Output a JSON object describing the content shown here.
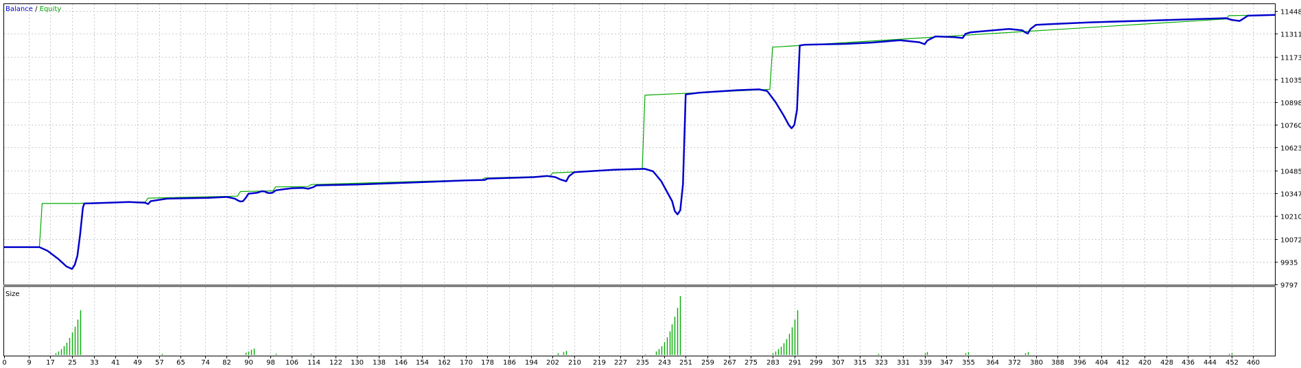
{
  "chart_data": {
    "type": "line",
    "legend": {
      "placement": "top-left",
      "separator": " / ",
      "series": [
        {
          "name": "Balance",
          "color": "#0000cc"
        },
        {
          "name": "Equity",
          "color": "#00aa00"
        }
      ]
    },
    "y_axis": {
      "ticks": [
        "11448",
        "11311",
        "11173",
        "11035",
        "10898",
        "10760",
        "10623",
        "10485",
        "10347",
        "10210",
        "10072",
        "9935",
        "9797"
      ],
      "range": [
        9797,
        11490
      ]
    },
    "x_axis": {
      "ticks": [
        "0",
        "9",
        "17",
        "25",
        "33",
        "41",
        "49",
        "57",
        "65",
        "74",
        "82",
        "90",
        "98",
        "106",
        "114",
        "122",
        "130",
        "138",
        "146",
        "154",
        "162",
        "170",
        "178",
        "186",
        "194",
        "202",
        "210",
        "219",
        "227",
        "235",
        "243",
        "251",
        "259",
        "267",
        "275",
        "283",
        "291",
        "299",
        "307",
        "315",
        "323",
        "331",
        "339",
        "347",
        "355",
        "364",
        "372",
        "380",
        "388",
        "396",
        "404",
        "412",
        "420",
        "428",
        "436",
        "444",
        "452",
        "460"
      ],
      "range": [
        0,
        468
      ]
    },
    "grid": true,
    "series": [
      {
        "name": "Balance",
        "color": "#0000cc",
        "x": [
          0,
          13,
          16,
          20,
          23,
          25,
          26,
          27,
          28,
          29,
          29.5,
          30,
          38,
          46,
          52,
          53,
          54,
          60,
          75,
          82,
          85,
          86,
          87,
          88,
          89,
          90,
          93,
          95,
          96,
          97,
          98,
          99,
          100,
          103,
          106,
          110,
          112,
          114,
          115,
          130,
          150,
          170,
          177,
          178,
          185,
          195,
          200,
          203,
          205,
          207,
          208,
          210,
          225,
          236,
          239,
          242,
          244,
          246,
          247,
          248,
          249,
          250,
          251,
          256,
          270,
          278,
          281,
          284,
          287,
          289,
          290,
          291,
          292,
          293,
          295,
          310,
          320,
          325,
          327,
          330,
          337,
          339,
          340,
          343,
          350,
          353,
          354,
          356,
          370,
          375,
          376,
          377,
          378,
          380,
          400,
          420,
          440,
          450,
          452,
          455,
          456,
          458,
          468
        ],
        "y": [
          10022,
          10022,
          10000,
          9950,
          9905,
          9890,
          9915,
          9970,
          10100,
          10260,
          10284,
          10286,
          10290,
          10295,
          10290,
          10282,
          10300,
          10315,
          10320,
          10325,
          10315,
          10305,
          10298,
          10300,
          10320,
          10345,
          10350,
          10360,
          10358,
          10350,
          10348,
          10352,
          10365,
          10372,
          10378,
          10380,
          10375,
          10385,
          10395,
          10400,
          10412,
          10425,
          10428,
          10436,
          10440,
          10445,
          10452,
          10445,
          10430,
          10420,
          10450,
          10475,
          10490,
          10495,
          10480,
          10420,
          10360,
          10300,
          10240,
          10220,
          10245,
          10400,
          10945,
          10955,
          10970,
          10975,
          10965,
          10900,
          10820,
          10760,
          10740,
          10760,
          10850,
          11240,
          11245,
          11250,
          11258,
          11265,
          11268,
          11272,
          11260,
          11248,
          11270,
          11295,
          11290,
          11285,
          11310,
          11320,
          11340,
          11332,
          11320,
          11312,
          11340,
          11365,
          11380,
          11390,
          11400,
          11405,
          11395,
          11388,
          11398,
          11420,
          11425
        ]
      },
      {
        "name": "Equity",
        "color": "#00aa00",
        "x": [
          0,
          13,
          14,
          28,
          29,
          52,
          53,
          86,
          87,
          99,
          100,
          112,
          113,
          176,
          177,
          201,
          202,
          235,
          236,
          282,
          283,
          450,
          451,
          468
        ],
        "y": [
          10022,
          10022,
          10286,
          10286,
          10288,
          10295,
          10318,
          10330,
          10358,
          10362,
          10386,
          10388,
          10400,
          10430,
          10440,
          10450,
          10470,
          10495,
          10940,
          10975,
          11230,
          11400,
          11420,
          11425
        ]
      }
    ],
    "subchart": {
      "title": "Size",
      "type": "bar",
      "color": "#00aa00",
      "bars": [
        {
          "x": 19,
          "v": 0.03
        },
        {
          "x": 20,
          "v": 0.06
        },
        {
          "x": 21,
          "v": 0.1
        },
        {
          "x": 22,
          "v": 0.15
        },
        {
          "x": 23,
          "v": 0.21
        },
        {
          "x": 24,
          "v": 0.29
        },
        {
          "x": 25,
          "v": 0.38
        },
        {
          "x": 26,
          "v": 0.48
        },
        {
          "x": 27,
          "v": 0.6
        },
        {
          "x": 28,
          "v": 0.76
        },
        {
          "x": 58,
          "v": 0.02
        },
        {
          "x": 89,
          "v": 0.04
        },
        {
          "x": 90,
          "v": 0.06
        },
        {
          "x": 91,
          "v": 0.09
        },
        {
          "x": 92,
          "v": 0.11
        },
        {
          "x": 100,
          "v": 0.02
        },
        {
          "x": 113,
          "v": 0.02
        },
        {
          "x": 204,
          "v": 0.03
        },
        {
          "x": 206,
          "v": 0.05
        },
        {
          "x": 207,
          "v": 0.07
        },
        {
          "x": 236,
          "v": 0.01
        },
        {
          "x": 240,
          "v": 0.06
        },
        {
          "x": 241,
          "v": 0.1
        },
        {
          "x": 242,
          "v": 0.15
        },
        {
          "x": 243,
          "v": 0.22
        },
        {
          "x": 244,
          "v": 0.3
        },
        {
          "x": 245,
          "v": 0.4
        },
        {
          "x": 246,
          "v": 0.52
        },
        {
          "x": 247,
          "v": 0.65
        },
        {
          "x": 248,
          "v": 0.8
        },
        {
          "x": 249,
          "v": 1.0
        },
        {
          "x": 283,
          "v": 0.03
        },
        {
          "x": 284,
          "v": 0.06
        },
        {
          "x": 285,
          "v": 0.1
        },
        {
          "x": 286,
          "v": 0.14
        },
        {
          "x": 287,
          "v": 0.2
        },
        {
          "x": 288,
          "v": 0.27
        },
        {
          "x": 289,
          "v": 0.36
        },
        {
          "x": 290,
          "v": 0.47
        },
        {
          "x": 291,
          "v": 0.6
        },
        {
          "x": 292,
          "v": 0.76
        },
        {
          "x": 322,
          "v": 0.02
        },
        {
          "x": 339,
          "v": 0.03
        },
        {
          "x": 340,
          "v": 0.05
        },
        {
          "x": 354,
          "v": 0.03
        },
        {
          "x": 355,
          "v": 0.05
        },
        {
          "x": 376,
          "v": 0.03
        },
        {
          "x": 377,
          "v": 0.05
        },
        {
          "x": 451,
          "v": 0.02
        },
        {
          "x": 452,
          "v": 0.03
        }
      ]
    }
  }
}
